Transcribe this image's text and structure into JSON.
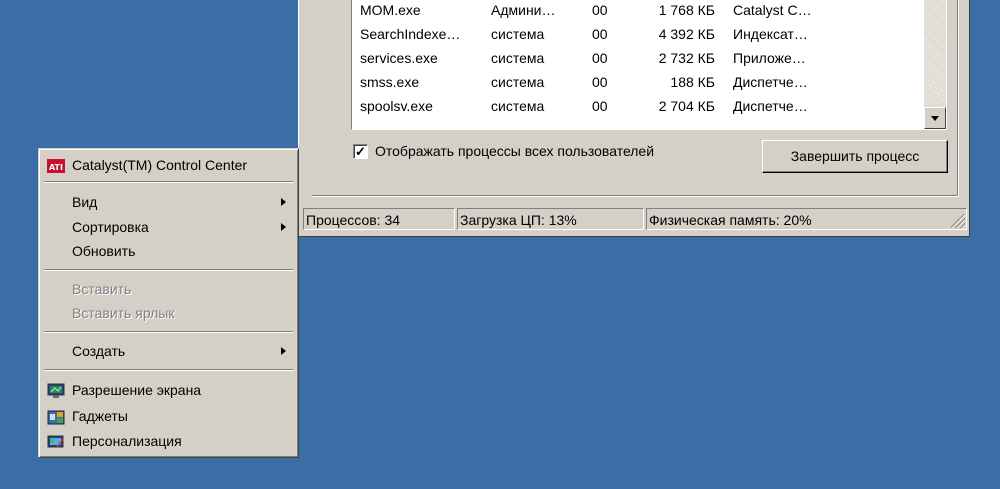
{
  "task_manager": {
    "processes": [
      {
        "name": "MOM.exe",
        "user": "Админи…",
        "cpu": "00",
        "memory": "1 768 КБ",
        "description": "Catalyst C…"
      },
      {
        "name": "SearchIndexe…",
        "user": "система",
        "cpu": "00",
        "memory": "4 392 КБ",
        "description": "Индексат…"
      },
      {
        "name": "services.exe",
        "user": "система",
        "cpu": "00",
        "memory": "2 732 КБ",
        "description": "Приложе…"
      },
      {
        "name": "smss.exe",
        "user": "система",
        "cpu": "00",
        "memory": "188 КБ",
        "description": "Диспетче…"
      },
      {
        "name": "spoolsv.exe",
        "user": "система",
        "cpu": "00",
        "memory": "2 704 КБ",
        "description": "Диспетче…"
      }
    ],
    "show_all_users_label": "Отображать процессы всех пользователей",
    "show_all_users_checked": true,
    "end_process_label": "Завершить процесс",
    "status": {
      "processes": "Процессов: 34",
      "cpu": "Загрузка ЦП: 13%",
      "memory": "Физическая память: 20%"
    }
  },
  "context_menu": {
    "catalyst": {
      "label": "Catalyst(TM) Control Center",
      "icon": "ati-logo-icon"
    },
    "view": {
      "label": "Вид"
    },
    "sort": {
      "label": "Сортировка"
    },
    "refresh": {
      "label": "Обновить"
    },
    "paste": {
      "label": "Вставить",
      "disabled": true
    },
    "paste_shortcut": {
      "label": "Вставить ярлык",
      "disabled": true
    },
    "create": {
      "label": "Создать"
    },
    "screen_resolution": {
      "label": "Разрешение экрана",
      "icon": "monitor-icon"
    },
    "gadgets": {
      "label": "Гаджеты",
      "icon": "gadgets-icon"
    },
    "personalization": {
      "label": "Персонализация",
      "icon": "personalization-icon"
    }
  },
  "colors": {
    "desktop": "#3a6ea5",
    "face": "#d4d0c8",
    "disabled_text": "#808080"
  }
}
